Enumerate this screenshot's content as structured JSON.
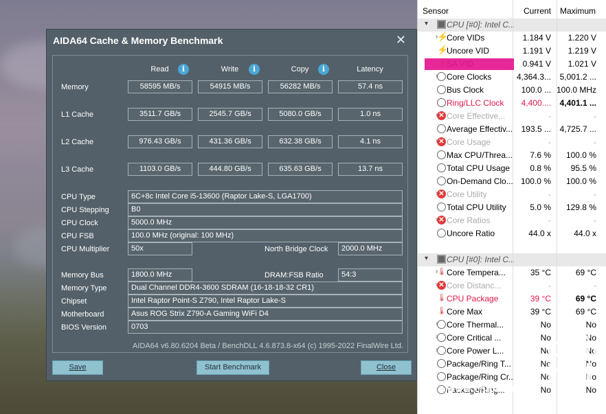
{
  "aida": {
    "title": "AIDA64 Cache & Memory Benchmark",
    "close_glyph": "✕",
    "columns": [
      "Read",
      "Write",
      "Copy",
      "Latency"
    ],
    "info_glyph": "i",
    "rows": [
      {
        "label": "Memory",
        "read": "58595 MB/s",
        "write": "54915 MB/s",
        "copy": "56282 MB/s",
        "latency": "57.4 ns"
      },
      {
        "label": "L1 Cache",
        "read": "3511.7 GB/s",
        "write": "2545.7 GB/s",
        "copy": "5080.0 GB/s",
        "latency": "1.0 ns"
      },
      {
        "label": "L2 Cache",
        "read": "976.43 GB/s",
        "write": "431.36 GB/s",
        "copy": "632.38 GB/s",
        "latency": "4.1 ns"
      },
      {
        "label": "L3 Cache",
        "read": "1103.0 GB/s",
        "write": "444.80 GB/s",
        "copy": "635.63 GB/s",
        "latency": "13.7 ns"
      }
    ],
    "info": {
      "cpu_type_label": "CPU Type",
      "cpu_type": "6C+8c Intel Core i5-13600  (Raptor Lake-S, LGA1700)",
      "cpu_stepping_label": "CPU Stepping",
      "cpu_stepping": "B0",
      "cpu_clock_label": "CPU Clock",
      "cpu_clock": "5000.0 MHz",
      "cpu_fsb_label": "CPU FSB",
      "cpu_fsb": "100.0 MHz  (original: 100 MHz)",
      "cpu_mult_label": "CPU Multiplier",
      "cpu_mult": "50x",
      "nb_clock_label": "North Bridge Clock",
      "nb_clock": "2000.0 MHz",
      "mem_bus_label": "Memory Bus",
      "mem_bus": "1800.0 MHz",
      "dram_ratio_label": "DRAM:FSB Ratio",
      "dram_ratio": "54:3",
      "mem_type_label": "Memory Type",
      "mem_type": "Dual Channel DDR4-3600 SDRAM  (16-18-18-32 CR1)",
      "chipset_label": "Chipset",
      "chipset": "Intel Raptor Point-S Z790, Intel Raptor Lake-S",
      "mobo_label": "Motherboard",
      "mobo": "Asus ROG Strix Z790-A Gaming WiFi D4",
      "bios_label": "BIOS Version",
      "bios": "0703"
    },
    "footer": "AIDA64 v6.80.6204 Beta / BenchDLL 4.6.873.8-x64  (c) 1995-2022 FinalWire Ltd.",
    "buttons": {
      "save": "Save",
      "start": "Start Benchmark",
      "close": "Close"
    }
  },
  "sensor": {
    "headers": {
      "sensor": "Sensor",
      "current": "Current",
      "maximum": "Maximum"
    },
    "rows": [
      {
        "expand": "⌄",
        "icon": "chip-icon",
        "name": "CPU [#0]: Intel C...",
        "cur": "",
        "max": "",
        "group": true
      },
      {
        "expand": "›",
        "icon": "bolt-icon",
        "name": "Core VIDs",
        "cur": "1.184 V",
        "max": "1.220 V"
      },
      {
        "expand": "",
        "icon": "bolt-icon",
        "name": "Uncore VID",
        "cur": "1.191 V",
        "max": "1.219 V"
      },
      {
        "expand": "",
        "icon": "bolt-icon",
        "name": "SA VID",
        "cur": "0.941 V",
        "max": "1.021 V"
      },
      {
        "expand": "›",
        "icon": "circle-icon",
        "name": "Core Clocks",
        "cur": "4,364.3...",
        "max": "5,001.2 ..."
      },
      {
        "expand": "",
        "icon": "circle-icon",
        "name": "Bus Clock",
        "cur": "100.0 ...",
        "max": "100.0 MHz"
      },
      {
        "expand": "",
        "icon": "circle-icon",
        "name": "Ring/LLC Clock",
        "cur": "4,400....",
        "max": "4,401.1 ...",
        "red": true
      },
      {
        "expand": "›",
        "icon": "x-icon",
        "name": "Core Effective...",
        "cur": "-",
        "max": "-",
        "grey": true
      },
      {
        "expand": "",
        "icon": "circle-icon",
        "name": "Average Effectiv...",
        "cur": "193.5 ...",
        "max": "4,725.7 ..."
      },
      {
        "expand": "›",
        "icon": "x-icon",
        "name": "Core Usage",
        "cur": "-",
        "max": "-",
        "grey": true
      },
      {
        "expand": "",
        "icon": "circle-icon",
        "name": "Max CPU/Threa...",
        "cur": "7.6 %",
        "max": "100.0 %"
      },
      {
        "expand": "",
        "icon": "circle-icon",
        "name": "Total CPU Usage",
        "cur": "0.8 %",
        "max": "95.5 %"
      },
      {
        "expand": "",
        "icon": "circle-icon",
        "name": "On-Demand Clo...",
        "cur": "100.0 %",
        "max": "100.0 %"
      },
      {
        "expand": "›",
        "icon": "x-icon",
        "name": "Core Utility",
        "cur": "-",
        "max": "-",
        "grey": true
      },
      {
        "expand": "",
        "icon": "circle-icon",
        "name": "Total CPU Utility",
        "cur": "5.0 %",
        "max": "129.8 %"
      },
      {
        "expand": "›",
        "icon": "x-icon",
        "name": "Core Ratios",
        "cur": "-",
        "max": "-",
        "grey": true
      },
      {
        "expand": "",
        "icon": "circle-icon",
        "name": "Uncore Ratio",
        "cur": "44.0 x",
        "max": "44.0 x"
      },
      {
        "expand": "⌄",
        "icon": "chip-icon",
        "name": "CPU [#0]: Intel C...",
        "cur": "",
        "max": "",
        "group": true
      },
      {
        "expand": "›",
        "icon": "therm-icon",
        "name": "Core Tempera...",
        "cur": "35 °C",
        "max": "69 °C"
      },
      {
        "expand": "›",
        "icon": "x-icon",
        "name": "Core Distanc...",
        "cur": "-",
        "max": "-",
        "grey": true
      },
      {
        "expand": "",
        "icon": "therm-icon",
        "name": "CPU Package",
        "cur": "39 °C",
        "max": "69 °C",
        "red": true
      },
      {
        "expand": "",
        "icon": "therm-icon",
        "name": "Core Max",
        "cur": "39 °C",
        "max": "69 °C"
      },
      {
        "expand": "›",
        "icon": "circle-icon",
        "name": "Core Thermal...",
        "cur": "No",
        "max": "No"
      },
      {
        "expand": "›",
        "icon": "circle-icon",
        "name": "Core Critical ...",
        "cur": "No",
        "max": "No"
      },
      {
        "expand": "›",
        "icon": "circle-icon",
        "name": "Core Power L...",
        "cur": "No",
        "max": "No"
      },
      {
        "expand": "",
        "icon": "circle-icon",
        "name": "Package/Ring T...",
        "cur": "No",
        "max": "No"
      },
      {
        "expand": "",
        "icon": "circle-icon",
        "name": "Package/Ring Cr...",
        "cur": "No",
        "max": "No"
      },
      {
        "expand": "",
        "icon": "circle-icon",
        "name": "Package/Ring...",
        "cur": "No",
        "max": "No"
      }
    ]
  },
  "watermark": {
    "big": "chip hell",
    "url": "www.chiphell.com"
  }
}
